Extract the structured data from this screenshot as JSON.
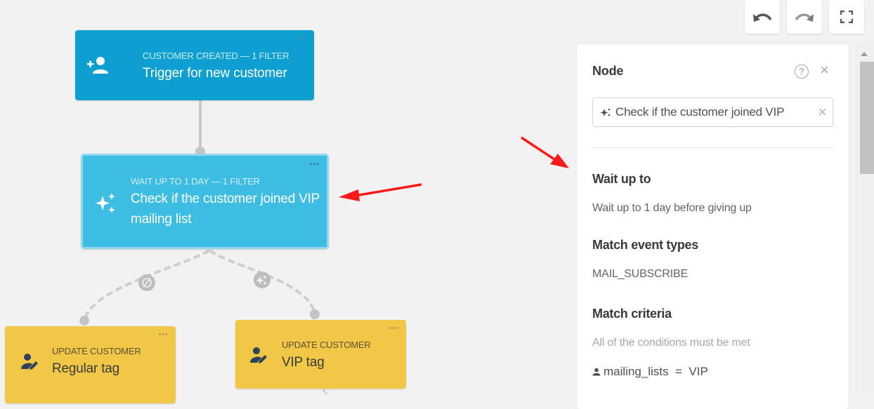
{
  "toolbar": {
    "undo_icon": "undo-icon",
    "redo_icon": "redo-icon",
    "fullscreen_icon": "fullscreen-icon"
  },
  "workflow": {
    "nodes": [
      {
        "id": "trigger",
        "kicker": "CUSTOMER CREATED  — 1 FILTER",
        "title": "Trigger for new customer",
        "icon": "add-user-icon",
        "menu": "•••",
        "color": "#0c9fcf"
      },
      {
        "id": "wait",
        "kicker": "WAIT  UP TO 1 DAY — 1 FILTER",
        "title": "Check if the customer joined VIP mailing list",
        "icon": "sparkles-icon",
        "menu": "•••",
        "color": "#3ebde3",
        "selected": true
      },
      {
        "id": "regular",
        "kicker": "UPDATE CUSTOMER",
        "title": "Regular tag",
        "icon": "user-edit-icon",
        "menu": "•••",
        "color": "#f0c747"
      },
      {
        "id": "vip",
        "kicker": "UPDATE CUSTOMER",
        "title": "VIP tag",
        "icon": "user-edit-icon",
        "menu": "•••",
        "color": "#f0c747"
      }
    ],
    "branches": [
      {
        "label": "no-match",
        "icon": "not-matched-icon"
      },
      {
        "label": "match",
        "icon": "sparkles-icon"
      }
    ]
  },
  "panel": {
    "title": "Node",
    "help_icon": "?",
    "close_icon": "×",
    "selected_node": "Check if the customer joined VIP",
    "clear_icon": "×",
    "sections": {
      "wait_up_to": {
        "heading": "Wait up to",
        "value": "Wait up to 1 day before giving up"
      },
      "event_types": {
        "heading": "Match event types",
        "value": "MAIL_SUBSCRIBE"
      },
      "criteria": {
        "heading": "Match criteria",
        "description": "All of the conditions must be met",
        "condition": "mailing_lists  =  VIP"
      }
    }
  },
  "annotations": {
    "arrow_color": "#ff0000",
    "count": 2
  }
}
